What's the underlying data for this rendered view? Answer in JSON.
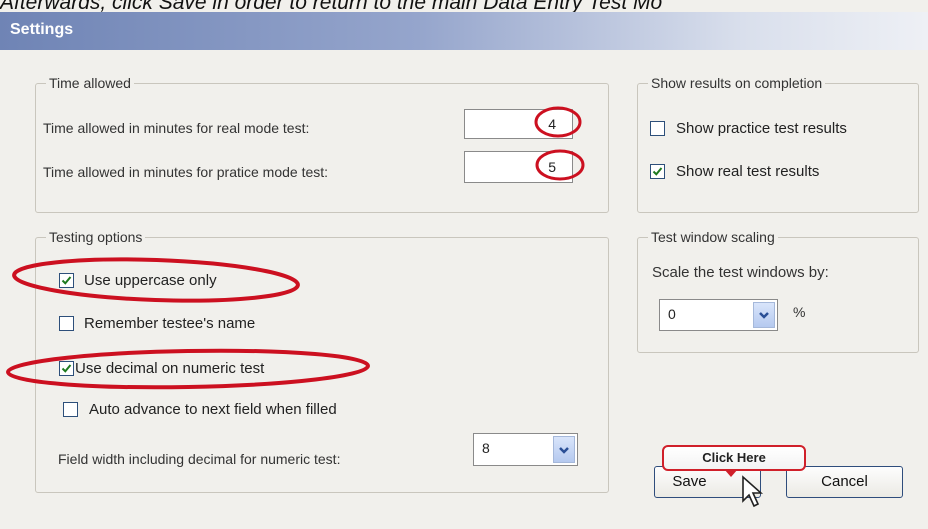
{
  "caption": "Afterwards, click Save in order to return to the main Data Entry Test Mo",
  "window": {
    "title": "Settings"
  },
  "time_allowed": {
    "legend": "Time allowed",
    "real_label": "Time allowed in minutes for real mode test:",
    "real_value": "4",
    "practice_label": "Time allowed in minutes for pratice mode test:",
    "practice_value": "5"
  },
  "show_results": {
    "legend": "Show results on completion",
    "practice_label": "Show practice test results",
    "practice_checked": false,
    "real_label": "Show real test results",
    "real_checked": true
  },
  "testing_options": {
    "legend": "Testing options",
    "uppercase_label": "Use uppercase only",
    "uppercase_checked": true,
    "remember_label": "Remember testee's name",
    "remember_checked": false,
    "decimal_label": "Use decimal on numeric test",
    "decimal_checked": true,
    "auto_advance_label": "Auto advance to next field when filled",
    "auto_advance_checked": false,
    "field_width_label": "Field width including decimal for numeric test:",
    "field_width_value": "8"
  },
  "scaling": {
    "legend": "Test window scaling",
    "label": "Scale the test windows by:",
    "value": "0",
    "unit": "%"
  },
  "buttons": {
    "save": "Save",
    "cancel": "Cancel"
  },
  "callout": "Click Here",
  "colors": {
    "highlight": "#cc1020",
    "title_bar": "#6f84b5",
    "check": "#1e7a1e"
  }
}
